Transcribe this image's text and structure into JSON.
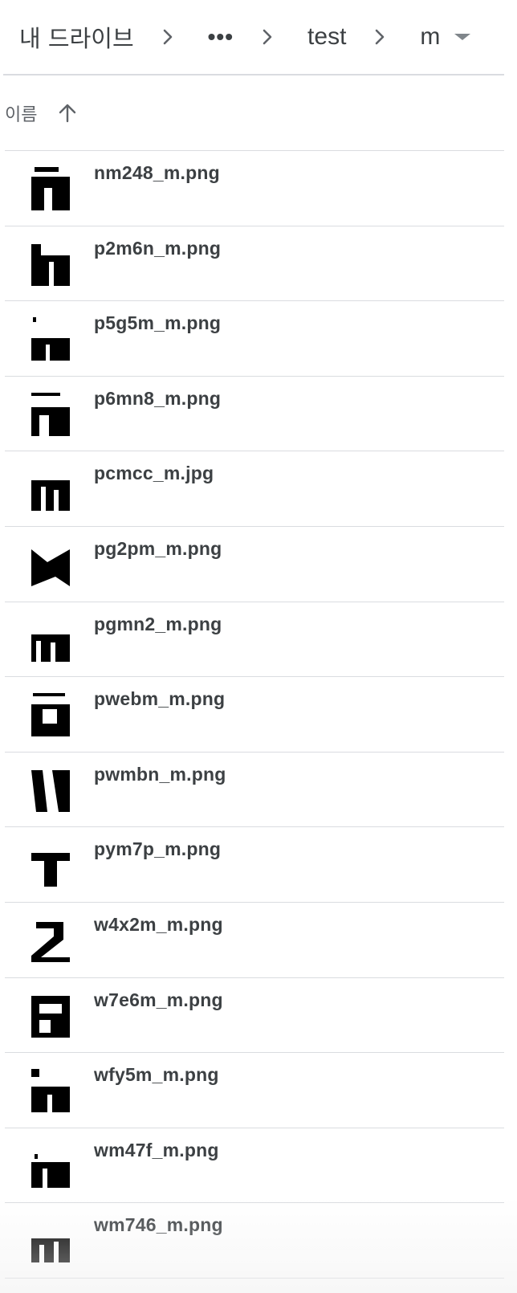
{
  "breadcrumb": {
    "root": "내 드라이브",
    "ellipsis": "•••",
    "folder": "test",
    "current": "m"
  },
  "header": {
    "name_label": "이름"
  },
  "files": [
    {
      "name": "nm248_m.png"
    },
    {
      "name": "p2m6n_m.png"
    },
    {
      "name": "p5g5m_m.png"
    },
    {
      "name": "p6mn8_m.png"
    },
    {
      "name": "pcmcc_m.jpg"
    },
    {
      "name": "pg2pm_m.png"
    },
    {
      "name": "pgmn2_m.png"
    },
    {
      "name": "pwebm_m.png"
    },
    {
      "name": "pwmbn_m.png"
    },
    {
      "name": "pym7p_m.png"
    },
    {
      "name": "w4x2m_m.png"
    },
    {
      "name": "w7e6m_m.png"
    },
    {
      "name": "wfy5m_m.png"
    },
    {
      "name": "wm47f_m.png"
    },
    {
      "name": "wm746_m.png"
    }
  ]
}
